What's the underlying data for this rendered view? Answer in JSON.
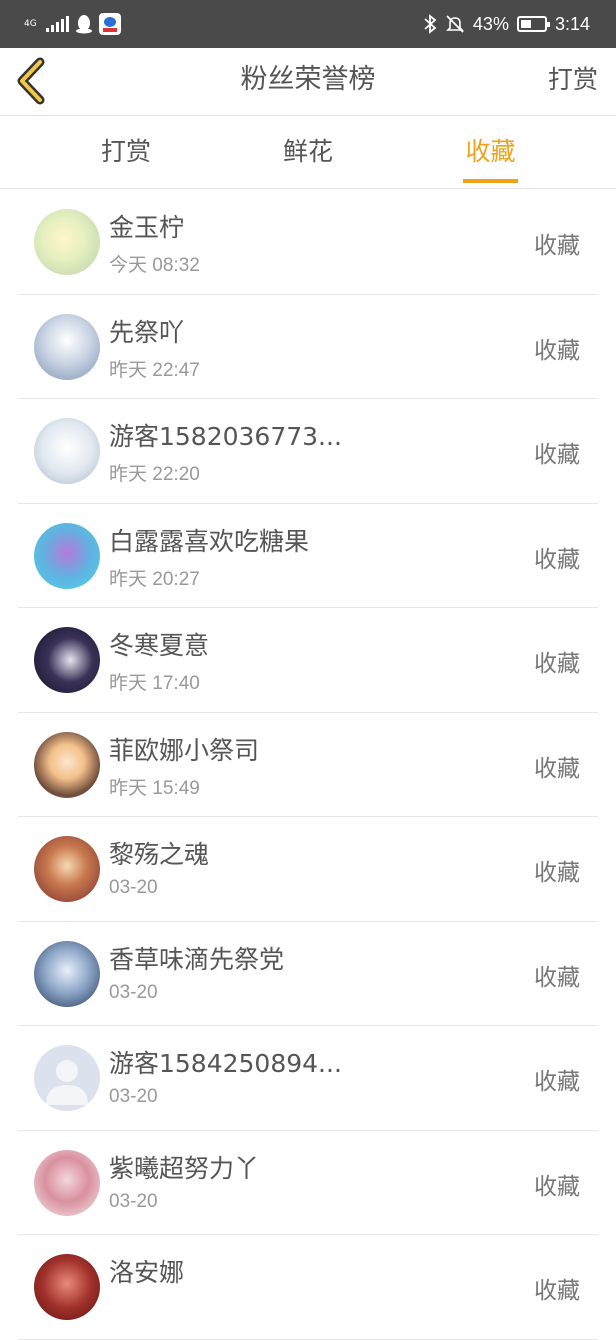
{
  "status_bar": {
    "network": "4G",
    "battery": "43%",
    "time": "3:14"
  },
  "header": {
    "title": "粉丝荣誉榜",
    "action": "打赏"
  },
  "tabs": [
    {
      "label": "打赏",
      "active": false
    },
    {
      "label": "鲜花",
      "active": false
    },
    {
      "label": "收藏",
      "active": true
    }
  ],
  "fans": [
    {
      "name": "金玉柠",
      "time": "今天 08:32",
      "action": "收藏"
    },
    {
      "name": "先祭吖",
      "time": "昨天 22:47",
      "action": "收藏"
    },
    {
      "name": "游客1582036773...",
      "time": "昨天 22:20",
      "action": "收藏"
    },
    {
      "name": "白露露喜欢吃糖果",
      "time": "昨天 20:27",
      "action": "收藏"
    },
    {
      "name": "冬寒夏意",
      "time": "昨天 17:40",
      "action": "收藏"
    },
    {
      "name": "菲欧娜小祭司",
      "time": "昨天 15:49",
      "action": "收藏"
    },
    {
      "name": "黎殇之魂",
      "time": "03-20",
      "action": "收藏"
    },
    {
      "name": "香草味滴先祭党",
      "time": "03-20",
      "action": "收藏"
    },
    {
      "name": "游客1584250894...",
      "time": "03-20",
      "action": "收藏"
    },
    {
      "name": "紫曦超努力丫",
      "time": "03-20",
      "action": "收藏"
    },
    {
      "name": "洛安娜",
      "time": "",
      "action": "收藏"
    }
  ],
  "colors": {
    "accent": "#f0a21b",
    "status_bar": "#4a4a4a",
    "text": "#555555",
    "subtext": "#999999"
  }
}
